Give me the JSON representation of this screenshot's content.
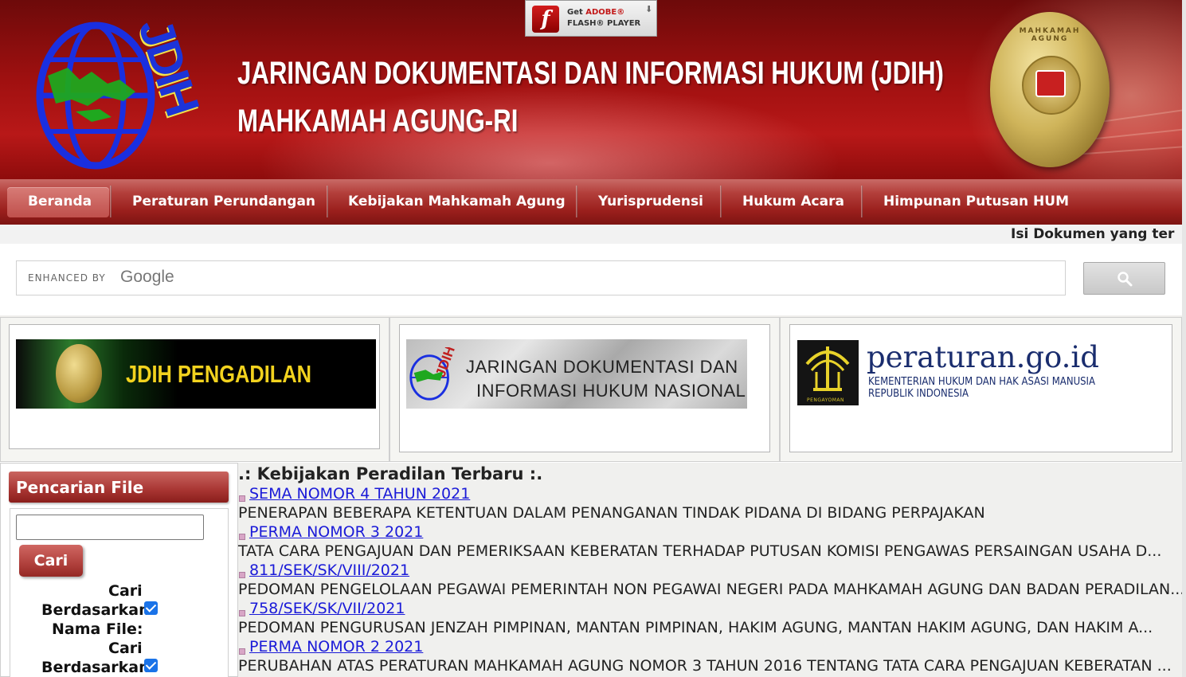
{
  "header": {
    "logo_text": "JDIH",
    "title_line1": "JARINGAN DOKUMENTASI DAN INFORMASI HUKUM (JDIH)",
    "title_line2": "MAHKAMAH AGUNG-RI",
    "seal_text": "MAHKAMAH AGUNG"
  },
  "flash": {
    "get": "Get",
    "adobe": "ADOBE®",
    "product": "FLASH® PLAYER"
  },
  "nav": {
    "items": [
      {
        "label": "Beranda",
        "active": true
      },
      {
        "label": "Peraturan Perundangan"
      },
      {
        "label": "Kebijakan Mahkamah Agung"
      },
      {
        "label": "Yurisprudensi"
      },
      {
        "label": "Hukum Acara"
      },
      {
        "label": "Himpunan Putusan HUM"
      }
    ]
  },
  "marquee": {
    "text": "Isi Dokumen yang ter"
  },
  "search": {
    "enhanced_by": "ENHANCED BY",
    "google": "Google",
    "button_icon": "search-icon"
  },
  "banners": [
    {
      "text": "JDIH PENGADILAN"
    },
    {
      "line1": "JARINGAN DOKUMENTASI DAN",
      "line2": "INFORMASI HUKUM NASIONAL"
    },
    {
      "title": "peraturan.go.id",
      "line1": "KEMENTERIAN HUKUM DAN HAK ASASI MANUSIA",
      "line2": "REPUBLIK INDONESIA",
      "logo_caption": "PENGAYOMAN"
    }
  ],
  "left_panel": {
    "title": "Pencarian File",
    "file_value": "",
    "button": "Cari",
    "options": [
      {
        "line1": "Cari",
        "line2": "Berdasarkan",
        "line3": "Nama File:",
        "checked": true
      },
      {
        "line1": "Cari",
        "line2": "Berdasarkan",
        "checked": true
      }
    ]
  },
  "content": {
    "title": ".: Kebijakan Peradilan Terbaru :.",
    "documents": [
      {
        "link": "SEMA NOMOR 4 TAHUN 2021",
        "desc": "PENERAPAN BEBERAPA KETENTUAN DALAM PENANGANAN TINDAK PIDANA DI BIDANG PERPAJAKAN"
      },
      {
        "link": "PERMA NOMOR 3 2021",
        "desc": "TATA CARA PENGAJUAN DAN PEMERIKSAAN KEBERATAN TERHADAP PUTUSAN KOMISI PENGAWAS PERSAINGAN USAHA D..."
      },
      {
        "link": "811/SEK/SK/VIII/2021",
        "desc": "PEDOMAN PENGELOLAAN PEGAWAI PEMERINTAH NON PEGAWAI NEGERI PADA MAHKAMAH AGUNG DAN BADAN PERADILAN..."
      },
      {
        "link": "758/SEK/SK/VII/2021",
        "desc": "PEDOMAN PENGURUSAN JENZAH PIMPINAN, MANTAN PIMPINAN, HAKIM AGUNG, MANTAN HAKIM AGUNG, DAN HAKIM A..."
      },
      {
        "link": "PERMA NOMOR 2 2021",
        "desc": "PERUBAHAN ATAS PERATURAN MAHKAMAH AGUNG NOMOR 3 TAHUN 2016 TENTANG TATA CARA PENGAJUAN KEBERATAN ..."
      }
    ]
  },
  "colors": {
    "header_red": "#a01010",
    "nav_red": "#9a1f1c",
    "link_blue": "#1a1ad8",
    "banner_gold": "#f2d21e"
  }
}
